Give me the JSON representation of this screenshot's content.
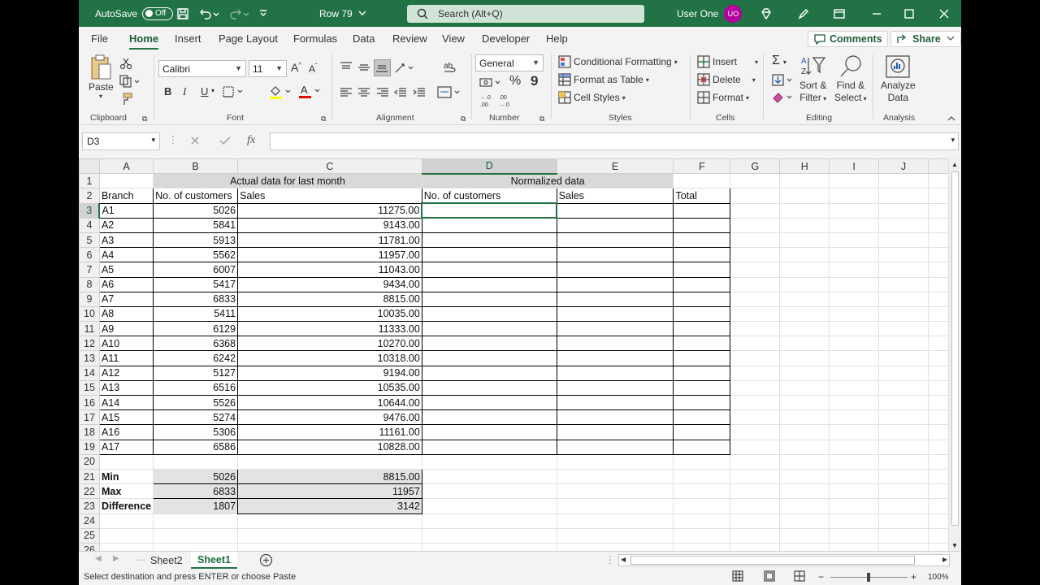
{
  "titlebar": {
    "autosave_label": "AutoSave",
    "autosave_state": "Off",
    "file_title": "Row 79",
    "search_placeholder": "Search (Alt+Q)",
    "user_name": "User One",
    "user_initials": "UO"
  },
  "menu": {
    "tabs": [
      "File",
      "Home",
      "Insert",
      "Page Layout",
      "Formulas",
      "Data",
      "Review",
      "View",
      "Developer",
      "Help"
    ],
    "active": "Home",
    "comments": "Comments",
    "share": "Share"
  },
  "ribbon": {
    "clipboard": {
      "paste": "Paste",
      "label": "Clipboard"
    },
    "font": {
      "name": "Calibri",
      "size": "11",
      "bold": "B",
      "italic": "I",
      "underline": "U",
      "label": "Font"
    },
    "alignment": {
      "label": "Alignment"
    },
    "number": {
      "format": "General",
      "percent": "%",
      "comma": "9",
      "label": "Number"
    },
    "styles": {
      "conditional": "Conditional Formatting",
      "format_table": "Format as Table",
      "cell_styles": "Cell Styles",
      "label": "Styles"
    },
    "cells": {
      "insert": "Insert",
      "delete": "Delete",
      "format": "Format",
      "label": "Cells"
    },
    "editing": {
      "sigma": "Σ",
      "sort1": "Sort &",
      "sort2": "Filter",
      "find1": "Find &",
      "find2": "Select",
      "label": "Editing"
    },
    "analysis": {
      "analyze1": "Analyze",
      "analyze2": "Data",
      "label": "Analysis"
    }
  },
  "formula_bar": {
    "name_box": "D3",
    "fx": "fx",
    "formula": ""
  },
  "columns": [
    "A",
    "B",
    "C",
    "D",
    "E",
    "F",
    "G",
    "H",
    "I",
    "J"
  ],
  "selected": {
    "col": "D",
    "row": 3
  },
  "headers": {
    "actual": "Actual data for last month",
    "normalized": "Normalized data",
    "branch": "Branch",
    "customers": "No. of customers",
    "sales": "Sales",
    "norm_customers": "No. of customers",
    "norm_sales": "Sales",
    "total": "Total"
  },
  "rows": [
    {
      "branch": "A1",
      "customers": "5026",
      "sales": "11275.00"
    },
    {
      "branch": "A2",
      "customers": "5841",
      "sales": "9143.00"
    },
    {
      "branch": "A3",
      "customers": "5913",
      "sales": "11781.00"
    },
    {
      "branch": "A4",
      "customers": "5562",
      "sales": "11957.00"
    },
    {
      "branch": "A5",
      "customers": "6007",
      "sales": "11043.00"
    },
    {
      "branch": "A6",
      "customers": "5417",
      "sales": "9434.00"
    },
    {
      "branch": "A7",
      "customers": "6833",
      "sales": "8815.00"
    },
    {
      "branch": "A8",
      "customers": "5411",
      "sales": "10035.00"
    },
    {
      "branch": "A9",
      "customers": "6129",
      "sales": "11333.00"
    },
    {
      "branch": "A10",
      "customers": "6368",
      "sales": "10270.00"
    },
    {
      "branch": "A11",
      "customers": "6242",
      "sales": "10318.00"
    },
    {
      "branch": "A12",
      "customers": "5127",
      "sales": "9194.00"
    },
    {
      "branch": "A13",
      "customers": "6516",
      "sales": "10535.00"
    },
    {
      "branch": "A14",
      "customers": "5526",
      "sales": "10644.00"
    },
    {
      "branch": "A15",
      "customers": "5274",
      "sales": "9476.00"
    },
    {
      "branch": "A16",
      "customers": "5306",
      "sales": "11161.00"
    },
    {
      "branch": "A17",
      "customers": "6586",
      "sales": "10828.00"
    }
  ],
  "summary": [
    {
      "label": "Min",
      "customers": "5026",
      "sales": "8815.00"
    },
    {
      "label": "Max",
      "customers": "6833",
      "sales": "11957"
    },
    {
      "label": "Difference",
      "customers": "1807",
      "sales": "3142"
    }
  ],
  "sheets": [
    "Sheet2",
    "Sheet1"
  ],
  "active_sheet": "Sheet1",
  "status": {
    "message": "Select destination and press ENTER or choose Paste",
    "zoom": "100%"
  }
}
